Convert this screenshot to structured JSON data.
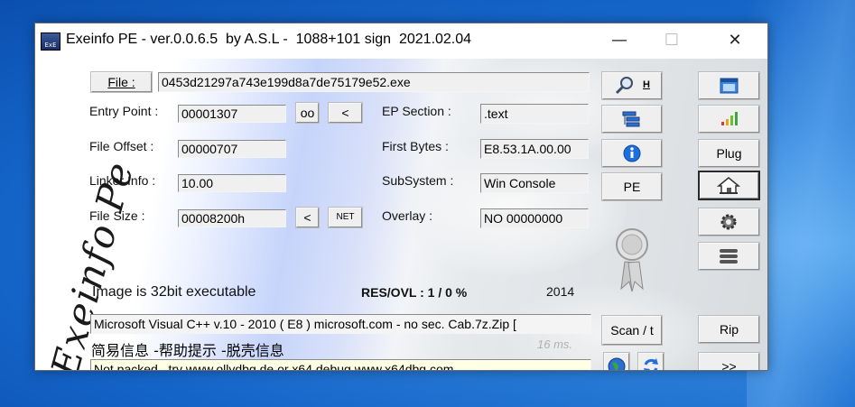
{
  "window": {
    "title": "Exeinfo PE - ver.0.0.6.5  by A.S.L -  1088+101 sign  2021.02.04",
    "icon_label": "ExE",
    "controls": {
      "minimize": "—",
      "maximize": "☐",
      "close": "✕"
    }
  },
  "logo": {
    "text": "Exeinfo Pe"
  },
  "file": {
    "button_label": "File :",
    "name": "0453d21297a743e199d8a7de75179e52.exe"
  },
  "fields": {
    "entry_point": {
      "label": "Entry Point :",
      "value": "00001307"
    },
    "file_offset": {
      "label": "File Offset :",
      "value": "00000707"
    },
    "linker_info": {
      "label": "Linker Info :",
      "value": "10.00"
    },
    "file_size": {
      "label": "File Size :",
      "value": "00008200h"
    },
    "ep_section": {
      "label": "EP Section :",
      "value": ".text"
    },
    "first_bytes": {
      "label": "First Bytes :",
      "value": "E8.53.1A.00.00"
    },
    "subsystem": {
      "label": "SubSystem :",
      "value": "Win Console"
    },
    "overlay": {
      "label": "Overlay :",
      "value": "NO   00000000"
    }
  },
  "small_buttons": {
    "oo": "oo",
    "lt1": "<",
    "lt2": "<",
    "net": "NET"
  },
  "info": {
    "image_type": "Image is 32bit executable",
    "res_ovl": "RES/OVL : 1 / 0 %",
    "year": "2014"
  },
  "detection": "Microsoft Visual C++ v.10 - 2010 ( E8 ) microsoft.com - no sec. Cab.7z.Zip [",
  "chinese_line": "简易信息 -帮助提示 -脱壳信息",
  "time": "16 ms.",
  "hint": "Not packed , try  www.ollydbg.de or x64 debug www.x64dbg.com",
  "middle_buttons": {
    "search_h": "H",
    "pe": "PE",
    "scan": "Scan / t"
  },
  "right_buttons": {
    "plug": "Plug",
    "rip": "Rip",
    "forward": ">>"
  },
  "colors": {
    "desktop": "#1464c8",
    "hint_bg": "#ffffe6",
    "accent_blue": "#2b6fd0"
  }
}
